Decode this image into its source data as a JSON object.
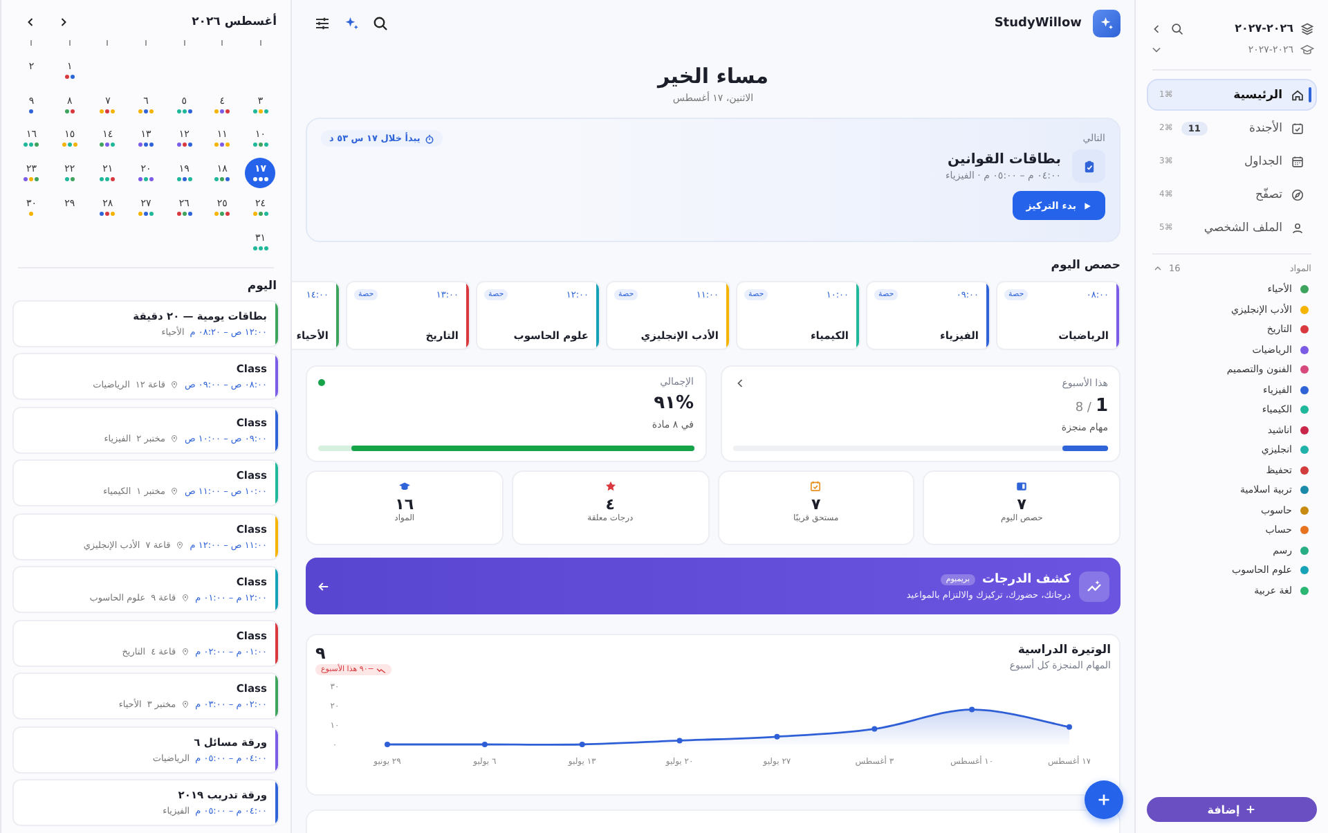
{
  "sidebar": {
    "year": "٢٠٢٦-٢٠٢٧",
    "term": "٢٠٢٦-٢٠٢٧",
    "nav": [
      {
        "label": "الرئيسية",
        "shortcut": "⌘1",
        "selected": true
      },
      {
        "label": "الأجندة",
        "shortcut": "⌘2",
        "badge": "11",
        "selected": false
      },
      {
        "label": "الجداول",
        "shortcut": "⌘3",
        "selected": false
      },
      {
        "label": "تصفّح",
        "shortcut": "⌘4",
        "selected": false
      },
      {
        "label": "الملف الشخصي",
        "shortcut": "⌘5",
        "selected": false
      }
    ],
    "subjects_title": "المواد",
    "subjects_count": "16",
    "subjects": [
      {
        "name": "الأحياء",
        "color": "#3da35d"
      },
      {
        "name": "الأدب الإنجليزي",
        "color": "#f4b400"
      },
      {
        "name": "التاريخ",
        "color": "#d9393e"
      },
      {
        "name": "الرياضيات",
        "color": "#7b5ce6"
      },
      {
        "name": "الفنون والتصميم",
        "color": "#d84a7e"
      },
      {
        "name": "الفيزياء",
        "color": "#2f63d8"
      },
      {
        "name": "الكيمياء",
        "color": "#1fb89a"
      },
      {
        "name": "اناشيد",
        "color": "#c8264a"
      },
      {
        "name": "انجليزي",
        "color": "#20b2aa"
      },
      {
        "name": "تحفيظ",
        "color": "#d23c3c"
      },
      {
        "name": "تربية اسلامية",
        "color": "#1b8aa8"
      },
      {
        "name": "حاسوب",
        "color": "#c98a10"
      },
      {
        "name": "حساب",
        "color": "#e8731e"
      },
      {
        "name": "رسم",
        "color": "#27ae84"
      },
      {
        "name": "علوم الحاسوب",
        "color": "#17a2b8"
      },
      {
        "name": "لغة عربية",
        "color": "#2bb673"
      }
    ],
    "add_button": "إضافة"
  },
  "topbar": {
    "brand": "StudyWillow"
  },
  "greeting": {
    "title": "مساء الخير",
    "date": "الاثنين، ١٧ أغسطس"
  },
  "next": {
    "label": "التالي",
    "countdown": "يبدأ خلال ١٧ س ٥٣ د",
    "title": "بطاقات القوانين",
    "meta": "٠٤:٠٠ م – ٠٥:٠٠ م · الفيزياء",
    "button": "بدء التركيز"
  },
  "classes": {
    "title": "حصص اليوم",
    "items": [
      {
        "time": "٠٨:٠٠",
        "badge": "حصة",
        "name": "الرياضيات",
        "color": "#7b5ce6"
      },
      {
        "time": "٠٩:٠٠",
        "badge": "حصة",
        "name": "الفيزياء",
        "color": "#2f63d8"
      },
      {
        "time": "١٠:٠٠",
        "badge": "حصة",
        "name": "الكيمياء",
        "color": "#1fb89a"
      },
      {
        "time": "١١:٠٠",
        "badge": "حصة",
        "name": "الأدب الإنجليزي",
        "color": "#f4b400"
      },
      {
        "time": "١٢:٠٠",
        "badge": "حصة",
        "name": "علوم الحاسوب",
        "color": "#17a2b8"
      },
      {
        "time": "١٣:٠٠",
        "badge": "حصة",
        "name": "التاريخ",
        "color": "#d9393e"
      },
      {
        "time": "١٤:٠٠",
        "name": "الأحياء",
        "color": "#3da35d"
      }
    ]
  },
  "week": {
    "label": "هذا الأسبوع",
    "done": "1",
    "total": "8 /",
    "caption": "مهام منجزة",
    "level": 0.12
  },
  "overall": {
    "label": "الإجمالي",
    "value": "%٩١",
    "caption": "في ٨ مادة",
    "level": 0.91
  },
  "stats": [
    {
      "value": "٧",
      "label": "حصص اليوم"
    },
    {
      "value": "٧",
      "label": "مستحق قريبًا"
    },
    {
      "value": "٤",
      "label": "درجات معلقة"
    },
    {
      "value": "١٦",
      "label": "المواد"
    }
  ],
  "banner": {
    "title": "كشف الدرجات",
    "badge": "بريميوم",
    "subtitle": "درجاتك، حضورك، تركيزك والالتزام بالمواعيد"
  },
  "pace": {
    "title": "الوتيرة الدراسية",
    "subtitle": "المهام المنجزة كل أسبوع",
    "value": "٩",
    "trend": "−٩٠ هذا الأسبوع",
    "chart_data": {
      "type": "area",
      "categories": [
        "٢٩ يونيو",
        "٦ يوليو",
        "١٣ يوليو",
        "٢٠ يوليو",
        "٢٧ يوليو",
        "٣ أغسطس",
        "١٠ أغسطس",
        "١٧ أغسطس"
      ],
      "series": [
        {
          "color": "#2f5fd6",
          "values": [
            0,
            0,
            0,
            2,
            4,
            8,
            18,
            9
          ]
        }
      ],
      "ylim": [
        0,
        30
      ],
      "yticks": [
        {
          "value": 0,
          "label": "٠"
        },
        {
          "value": 10,
          "label": "١٠"
        },
        {
          "value": 20,
          "label": "٢٠"
        },
        {
          "value": 30,
          "label": "٣٠"
        }
      ]
    }
  },
  "calendar": {
    "title": "أغسطس ٢٠٢٦",
    "weeks": [
      [
        {
          "day": "١",
          "selected": false,
          "dots": [
            {
              "color": "#2f63d8"
            },
            {
              "color": "#d9393e"
            }
          ]
        },
        {
          "day": "٢",
          "selected": false
        }
      ],
      [
        {
          "day": "٣",
          "selected": false,
          "dots": [
            {
              "color": "#1fb89a"
            },
            {
              "color": "#f4b400"
            },
            {
              "color": "#1fb89a"
            }
          ]
        },
        {
          "day": "٤",
          "selected": false,
          "dots": [
            {
              "color": "#d9393e"
            },
            {
              "color": "#7b5ce6"
            },
            {
              "color": "#f4b400"
            }
          ]
        },
        {
          "day": "٥",
          "selected": false,
          "dots": [
            {
              "color": "#2f63d8"
            },
            {
              "color": "#1fb89a"
            },
            {
              "color": "#1fb89a"
            }
          ]
        },
        {
          "day": "٦",
          "selected": false,
          "dots": [
            {
              "color": "#f4b400"
            },
            {
              "color": "#2f63d8"
            },
            {
              "color": "#f4b400"
            }
          ]
        },
        {
          "day": "٧",
          "selected": false,
          "dots": [
            {
              "color": "#f4b400"
            },
            {
              "color": "#d9393e"
            },
            {
              "color": "#f4b400"
            }
          ]
        },
        {
          "day": "٨",
          "selected": false,
          "dots": [
            {
              "color": "#d9393e"
            },
            {
              "color": "#3da35d"
            }
          ]
        },
        {
          "day": "٩",
          "selected": false,
          "dots": [
            {
              "color": "#2f63d8"
            }
          ]
        }
      ],
      [
        {
          "day": "١٠",
          "selected": false,
          "dots": [
            {
              "color": "#1fb89a"
            },
            {
              "color": "#3da35d"
            },
            {
              "color": "#1fb89a"
            }
          ]
        },
        {
          "day": "١١",
          "selected": false,
          "dots": [
            {
              "color": "#f4b400"
            },
            {
              "color": "#7b5ce6"
            },
            {
              "color": "#f4b400"
            }
          ]
        },
        {
          "day": "١٢",
          "selected": false,
          "dots": [
            {
              "color": "#2f63d8"
            },
            {
              "color": "#d9393e"
            },
            {
              "color": "#7b5ce6"
            }
          ]
        },
        {
          "day": "١٣",
          "selected": false,
          "dots": [
            {
              "color": "#2f63d8"
            },
            {
              "color": "#2f63d8"
            },
            {
              "color": "#7b5ce6"
            }
          ]
        },
        {
          "day": "١٤",
          "selected": false,
          "dots": [
            {
              "color": "#1fb89a"
            },
            {
              "color": "#7b5ce6"
            },
            {
              "color": "#3da35d"
            }
          ]
        },
        {
          "day": "١٥",
          "selected": false,
          "dots": [
            {
              "color": "#f4b400"
            },
            {
              "color": "#1fb89a"
            },
            {
              "color": "#f4b400"
            }
          ]
        },
        {
          "day": "١٦",
          "selected": false,
          "dots": [
            {
              "color": "#3da35d"
            },
            {
              "color": "#1fb89a"
            },
            {
              "color": "#1fb89a"
            }
          ]
        }
      ],
      [
        {
          "day": "١٧",
          "selected": true,
          "dots": [
            {
              "color": "#ffffff"
            },
            {
              "color": "#ffffff"
            },
            {
              "color": "#ffffff"
            }
          ]
        },
        {
          "day": "١٨",
          "selected": false,
          "dots": [
            {
              "color": "#2f63d8"
            },
            {
              "color": "#3da35d"
            },
            {
              "color": "#1fb89a"
            }
          ]
        },
        {
          "day": "١٩",
          "selected": false,
          "dots": [
            {
              "color": "#1fb89a"
            },
            {
              "color": "#2f63d8"
            },
            {
              "color": "#1fb89a"
            }
          ]
        },
        {
          "day": "٢٠",
          "selected": false,
          "dots": [
            {
              "color": "#7b5ce6"
            },
            {
              "color": "#1fb89a"
            },
            {
              "color": "#7b5ce6"
            }
          ]
        },
        {
          "day": "٢١",
          "selected": false,
          "dots": [
            {
              "color": "#d9393e"
            },
            {
              "color": "#1fb89a"
            },
            {
              "color": "#1fb89a"
            }
          ]
        },
        {
          "day": "٢٢",
          "selected": false,
          "dots": [
            {
              "color": "#3da35d"
            },
            {
              "color": "#1fb89a"
            }
          ]
        },
        {
          "day": "٢٣",
          "selected": false,
          "dots": [
            {
              "color": "#3da35d"
            },
            {
              "color": "#f4b400"
            },
            {
              "color": "#7b5ce6"
            }
          ]
        }
      ],
      [
        {
          "day": "٢٤",
          "selected": false,
          "dots": [
            {
              "color": "#1fb89a"
            },
            {
              "color": "#3da35d"
            },
            {
              "color": "#f4b400"
            }
          ]
        },
        {
          "day": "٢٥",
          "selected": false,
          "dots": [
            {
              "color": "#d9393e"
            },
            {
              "color": "#3da35d"
            },
            {
              "color": "#f4b400"
            }
          ]
        },
        {
          "day": "٢٦",
          "selected": false,
          "dots": [
            {
              "color": "#2f63d8"
            },
            {
              "color": "#3da35d"
            },
            {
              "color": "#d9393e"
            }
          ]
        },
        {
          "day": "٢٧",
          "selected": false,
          "dots": [
            {
              "color": "#1fb89a"
            },
            {
              "color": "#2f63d8"
            },
            {
              "color": "#f4b400"
            }
          ]
        },
        {
          "day": "٢٨",
          "selected": false,
          "dots": [
            {
              "color": "#f4b400"
            },
            {
              "color": "#d9393e"
            },
            {
              "color": "#2f63d8"
            }
          ]
        },
        {
          "day": "٢٩",
          "selected": false
        },
        {
          "day": "٣٠",
          "selected": false,
          "dots": [
            {
              "color": "#f4b400"
            }
          ]
        }
      ],
      [
        {
          "day": "٣١",
          "selected": false,
          "dots": [
            {
              "color": "#1fb89a"
            },
            {
              "color": "#1fb89a"
            },
            {
              "color": "#1fb89a"
            }
          ]
        }
      ]
    ]
  },
  "today": {
    "title": "اليوم",
    "items": [
      {
        "title": "بطاقات يومية — ٢٠ دقيقة",
        "time": "١٢:٠٠ ص – ٠٨:٢٠ م",
        "subject": "الأحياء",
        "color": "#3da35d"
      },
      {
        "title": "Class",
        "time": "٠٨:٠٠ ص – ٠٩:٠٠ ص",
        "location": "قاعة ١٢",
        "subject": "الرياضيات",
        "color": "#7b5ce6"
      },
      {
        "title": "Class",
        "time": "٠٩:٠٠ ص – ١٠:٠٠ ص",
        "location": "مختبر ٢",
        "subject": "الفيزياء",
        "color": "#2f63d8"
      },
      {
        "title": "Class",
        "time": "١٠:٠٠ ص – ١١:٠٠ ص",
        "location": "مختبر ١",
        "subject": "الكيمياء",
        "color": "#1fb89a"
      },
      {
        "title": "Class",
        "time": "١١:٠٠ ص – ١٢:٠٠ م",
        "location": "قاعة ٧",
        "subject": "الأدب الإنجليزي",
        "color": "#f4b400"
      },
      {
        "title": "Class",
        "time": "١٢:٠٠ م – ٠١:٠٠ م",
        "location": "قاعة ٩",
        "subject": "علوم الحاسوب",
        "color": "#17a2b8"
      },
      {
        "title": "Class",
        "time": "٠١:٠٠ م – ٠٢:٠٠ م",
        "location": "قاعة ٤",
        "subject": "التاريخ",
        "color": "#d9393e"
      },
      {
        "title": "Class",
        "time": "٠٢:٠٠ م – ٠٣:٠٠ م",
        "location": "مختبر ٣",
        "subject": "الأحياء",
        "color": "#3da35d"
      },
      {
        "title": "ورقة مسائل ٦",
        "time": "٠٤:٠٠ م – ٠٥:٠٠ م",
        "subject": "الرياضيات",
        "color": "#7b5ce6"
      },
      {
        "title": "ورقة تدريب ٢٠١٩",
        "time": "٠٤:٠٠ م – ٠٥:٠٠ م",
        "subject": "الفيزياء",
        "color": "#2f63d8"
      }
    ]
  }
}
